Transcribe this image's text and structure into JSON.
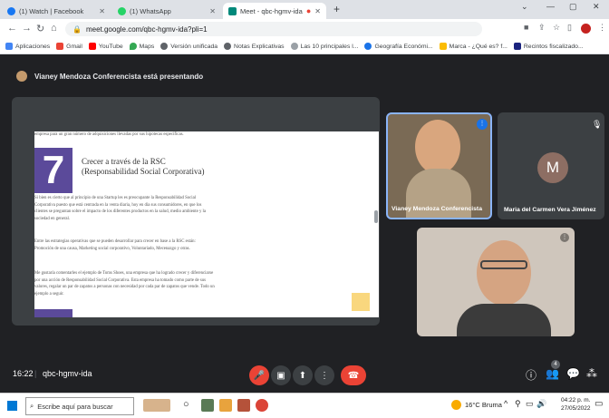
{
  "browser": {
    "tabs": [
      {
        "title": "(1) Watch | Facebook",
        "color": "#1877f2"
      },
      {
        "title": "(1) WhatsApp",
        "color": "#25d366"
      },
      {
        "title": "Meet - qbc-hgmv-ida",
        "color": "#00897b"
      }
    ],
    "new_tab": "+",
    "url": "meet.google.com/qbc-hgmv-ida?pli=1",
    "bookmarks": [
      "Aplicaciones",
      "Gmail",
      "YouTube",
      "Maps",
      "Versión unificada",
      "Notas Explicativas",
      "Las 10 principales l...",
      "Geografía Económi...",
      "Marca - ¿Qué es? f...",
      "Recintos fiscalizado..."
    ]
  },
  "meet": {
    "presenting_label": "Vianey Mendoza Conferencista está presentando",
    "meeting_time": "16:22",
    "meeting_code": "qbc-hgmv-ida",
    "participant_count": "4",
    "participants": [
      {
        "name": "Vianey Mendoza Conferencista"
      },
      {
        "name": "Maria del Carmen Vera Jiménez",
        "initial": "M"
      }
    ],
    "document": {
      "intro_line": "empresa para un gran número de adquisiciones llevadas por sus hipotecas específicas.",
      "big_number": "7",
      "heading_line1": "Crecer a través de la RSC",
      "heading_line2": "(Responsabilidad Social Corporativa)",
      "paragraph1": "Si bien es cierto que al principio de una Startup les es preocupante la Responsabilidad Social Corporativa puesto que está centrada en la venta diaria, hoy en día sus consumidores, en que los clientes se preguntan sobre el impacto de los diferentes productos en la salud, medio ambiente y la sociedad en general.",
      "paragraph2": "Entre las estrategias operativas que se pueden desarrollar para crecer en base a la RSC están: Promoción de una causa, Marketing social corporativo, Voluntariado, Mecenazgo y otras.",
      "paragraph3": "Me gustaría comentarles el ejemplo de Toms Shoes, una empresa que ha logrado crecer y diferenciarse por una acción de Responsabilidad Social Corporativa. Esta empresa ha tomado como parte de sus valores, regalar un par de zapatos a personas con necesidad por cada par de zapatos que vende. Todo un ejemplo a seguir."
    }
  },
  "taskbar": {
    "search_placeholder": "Escribe aquí para buscar",
    "weather": "16°C Bruma",
    "time": "04:22 p. m.",
    "date": "27/05/2022"
  }
}
